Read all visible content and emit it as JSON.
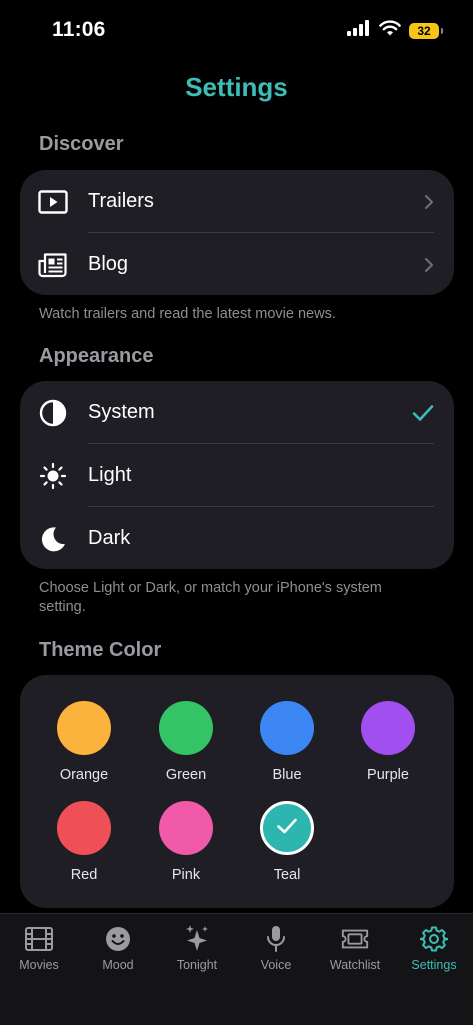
{
  "status_bar": {
    "time": "11:06",
    "battery": "32"
  },
  "title": "Settings",
  "discover": {
    "header": "Discover",
    "items": [
      {
        "label": "Trailers",
        "icon": "play-icon"
      },
      {
        "label": "Blog",
        "icon": "newspaper-icon"
      }
    ],
    "footnote": "Watch trailers and read the latest movie news."
  },
  "appearance": {
    "header": "Appearance",
    "items": [
      {
        "label": "System",
        "icon": "half-circle-icon",
        "selected": true
      },
      {
        "label": "Light",
        "icon": "sun-icon",
        "selected": false
      },
      {
        "label": "Dark",
        "icon": "moon-icon",
        "selected": false
      }
    ],
    "footnote": "Choose Light or Dark, or match your iPhone's system setting."
  },
  "theme_color": {
    "header": "Theme Color",
    "colors": [
      {
        "name": "Orange",
        "hex": "#fbb33d"
      },
      {
        "name": "Green",
        "hex": "#34c466"
      },
      {
        "name": "Blue",
        "hex": "#3d87f5"
      },
      {
        "name": "Purple",
        "hex": "#a24ff0"
      },
      {
        "name": "Red",
        "hex": "#ef5058"
      },
      {
        "name": "Pink",
        "hex": "#f05aa8"
      },
      {
        "name": "Teal",
        "hex": "#2db5b0"
      }
    ],
    "selected": "Teal"
  },
  "tab_bar": {
    "tabs": [
      {
        "label": "Movies",
        "icon": "film-icon"
      },
      {
        "label": "Mood",
        "icon": "smiley-icon"
      },
      {
        "label": "Tonight",
        "icon": "sparkles-icon"
      },
      {
        "label": "Voice",
        "icon": "microphone-icon"
      },
      {
        "label": "Watchlist",
        "icon": "ticket-icon"
      },
      {
        "label": "Settings",
        "icon": "gear-icon",
        "active": true
      }
    ]
  },
  "colors": {
    "accent": "#3dbdb8",
    "card": "#1e1e24",
    "background": "#000000"
  }
}
